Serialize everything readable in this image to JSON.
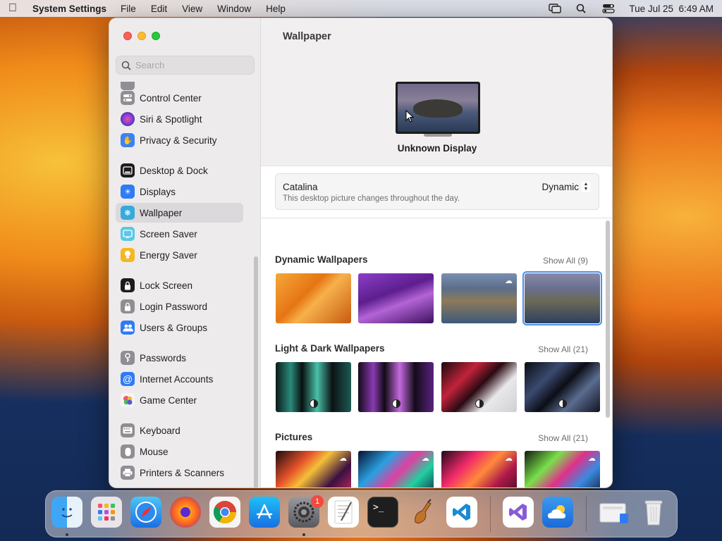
{
  "menubar": {
    "app_name": "System Settings",
    "menus": [
      "File",
      "Edit",
      "View",
      "Window",
      "Help"
    ],
    "clock": "Tue Jul 25  6:49 AM"
  },
  "sidebar": {
    "search_placeholder": "Search",
    "items": [
      {
        "label": "Control Center",
        "icon": "control-center-icon",
        "color": "#8e8e93"
      },
      {
        "label": "Siri & Spotlight",
        "icon": "siri-icon",
        "color": "#b93ad8"
      },
      {
        "label": "Privacy & Security",
        "icon": "hand-icon",
        "color": "#3b82f6"
      },
      {
        "label": "Desktop & Dock",
        "icon": "dock-icon",
        "color": "#1c1c1e"
      },
      {
        "label": "Displays",
        "icon": "sun-icon",
        "color": "#2f7bf6"
      },
      {
        "label": "Wallpaper",
        "icon": "flower-icon",
        "color": "#35aadc"
      },
      {
        "label": "Screen Saver",
        "icon": "screen-saver-icon",
        "color": "#5ac8e8"
      },
      {
        "label": "Energy Saver",
        "icon": "lightbulb-icon",
        "color": "#f5b820"
      },
      {
        "label": "Lock Screen",
        "icon": "lock-icon",
        "color": "#1c1c1e"
      },
      {
        "label": "Login Password",
        "icon": "lock-icon",
        "color": "#8e8e93"
      },
      {
        "label": "Users & Groups",
        "icon": "users-icon",
        "color": "#2f7bf6"
      },
      {
        "label": "Passwords",
        "icon": "key-icon",
        "color": "#8e8e93"
      },
      {
        "label": "Internet Accounts",
        "icon": "at-icon",
        "color": "#2f7bf6"
      },
      {
        "label": "Game Center",
        "icon": "game-center-icon",
        "color": "#ffffff"
      },
      {
        "label": "Keyboard",
        "icon": "keyboard-icon",
        "color": "#8e8e93"
      },
      {
        "label": "Mouse",
        "icon": "mouse-icon",
        "color": "#8e8e93"
      },
      {
        "label": "Printers & Scanners",
        "icon": "printer-icon",
        "color": "#8e8e93"
      }
    ],
    "active": "Wallpaper"
  },
  "main": {
    "title": "Wallpaper",
    "display_name": "Unknown Display",
    "current": {
      "name": "Catalina",
      "description": "This desktop picture changes throughout the day.",
      "mode": "Dynamic"
    },
    "sections": [
      {
        "title": "Dynamic Wallpapers",
        "show_all": "Show All (9)"
      },
      {
        "title": "Light & Dark Wallpapers",
        "show_all": "Show All (21)"
      },
      {
        "title": "Pictures",
        "show_all": "Show All (21)"
      }
    ]
  },
  "dock": {
    "apps": [
      "Finder",
      "Launchpad",
      "Safari",
      "Firefox",
      "Chrome",
      "App Store",
      "System Settings",
      "TextEdit",
      "Terminal",
      "Instruments",
      "Visual Studio Code",
      "Visual Studio",
      "Weather",
      "Downloads",
      "Trash"
    ],
    "settings_badge": "1"
  },
  "colors": {
    "accent": "#4a8ff0"
  }
}
